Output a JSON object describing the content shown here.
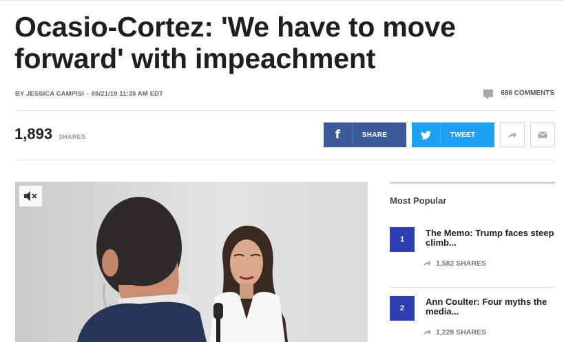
{
  "article": {
    "headline_line1": "Ocasio-Cortez: 'We have to move",
    "headline_line2": "forward' with impeachment",
    "byline_author": "BY JESSICA CAMPISI",
    "byline_date": "05/21/19 11:35 AM EDT",
    "comments_label": "686 COMMENTS"
  },
  "share_bar": {
    "count": "1,893",
    "count_label": "SHARES",
    "facebook_label": "SHARE",
    "twitter_label": "TWEET",
    "facebook_color": "#3b5998",
    "twitter_color": "#1da1f2"
  },
  "video": {
    "mute_icon": "speaker-muted-icon"
  },
  "sidebar": {
    "title": "Most Popular",
    "items": [
      {
        "rank": "1",
        "title": "The Memo: Trump faces steep climb...",
        "shares": "1,582 SHARES"
      },
      {
        "rank": "2",
        "title": "Ann Coulter: Four myths the media...",
        "shares": "1,228 SHARES"
      }
    ],
    "rank_color": "#2d3fb3"
  }
}
